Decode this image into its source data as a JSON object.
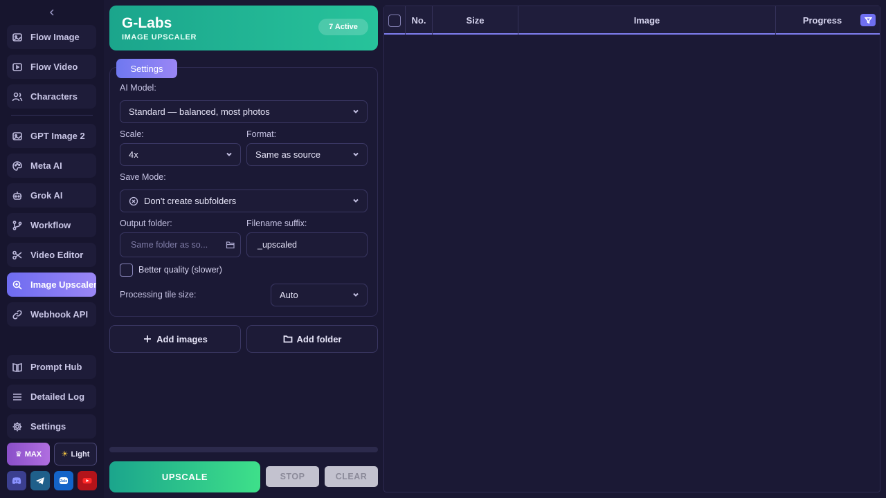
{
  "sidebar": {
    "items": [
      {
        "label": "Flow Image",
        "icon": "image-icon"
      },
      {
        "label": "Flow Video",
        "icon": "video-icon"
      },
      {
        "label": "Characters",
        "icon": "users-icon"
      },
      {
        "label": "GPT Image 2",
        "icon": "image-icon"
      },
      {
        "label": "Meta AI",
        "icon": "palette-icon"
      },
      {
        "label": "Grok AI",
        "icon": "robot-icon"
      },
      {
        "label": "Workflow",
        "icon": "branch-icon"
      },
      {
        "label": "Video Editor",
        "icon": "scissors-icon"
      },
      {
        "label": "Image Upscaler",
        "icon": "zoom-in-icon",
        "active": true
      },
      {
        "label": "Webhook API",
        "icon": "link-icon"
      },
      {
        "label": "Prompt Hub",
        "icon": "book-icon"
      },
      {
        "label": "Detailed Log",
        "icon": "list-icon"
      },
      {
        "label": "Settings",
        "icon": "gear-icon"
      }
    ],
    "max_badge": "MAX",
    "theme_toggle": "Light",
    "social": [
      "discord-icon",
      "telegram-icon",
      "zalo-icon",
      "youtube-icon"
    ]
  },
  "hero": {
    "title": "G-Labs",
    "subtitle": "IMAGE UPSCALER",
    "active_badge": "7 Active"
  },
  "settings": {
    "tab_label": "Settings",
    "ai_model_label": "AI Model:",
    "ai_model_value": "Standard — balanced, most photos",
    "scale_label": "Scale:",
    "scale_value": "4x",
    "format_label": "Format:",
    "format_value": "Same as source",
    "save_mode_label": "Save Mode:",
    "save_mode_value": "Don't create subfolders",
    "output_folder_label": "Output folder:",
    "output_folder_placeholder": "Same folder as so...",
    "filename_suffix_label": "Filename suffix:",
    "filename_suffix_value": "_upscaled",
    "better_quality_label": "Better quality (slower)",
    "better_quality_checked": false,
    "tile_size_label": "Processing tile size:",
    "tile_size_value": "Auto"
  },
  "actions": {
    "add_images": "Add images",
    "add_folder": "Add folder",
    "upscale": "UPSCALE",
    "stop": "STOP",
    "clear": "CLEAR"
  },
  "table": {
    "columns": [
      "No.",
      "Size",
      "Image",
      "Progress"
    ],
    "rows": []
  },
  "colors": {
    "accent": "#7f7ef0",
    "brand_green": "#1ba58c",
    "background": "#1a1833"
  }
}
